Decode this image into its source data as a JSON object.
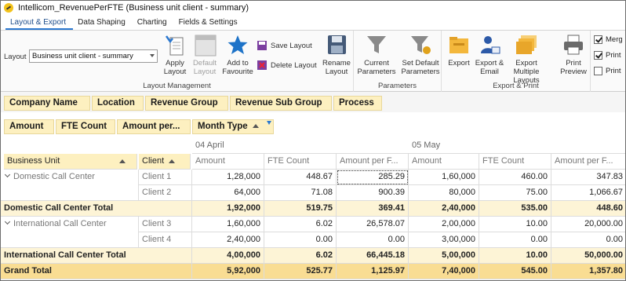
{
  "window": {
    "title": "Intellicom_RevenuePerFTE (Business unit client - summary)"
  },
  "tabs": [
    "Layout & Export",
    "Data Shaping",
    "Charting",
    "Fields & Settings"
  ],
  "ribbon": {
    "layout_label": "Layout",
    "layout_value": "Business unit client - summary",
    "apply_layout": "Apply Layout",
    "default_layout": "Default Layout",
    "add_to_favourite": "Add to Favourite",
    "save_layout": "Save Layout",
    "delete_layout": "Delete Layout",
    "rename_layout": "Rename Layout",
    "group_layout": "Layout Management",
    "current_parameters": "Current Parameters",
    "set_default_parameters": "Set Default Parameters",
    "group_parameters": "Parameters",
    "export": "Export",
    "export_email": "Export & Email",
    "export_multiple": "Export Multiple Layouts",
    "print_preview": "Print Preview",
    "group_export": "Export & Print",
    "options": [
      {
        "label": "Merg",
        "checked": true
      },
      {
        "label": "Print",
        "checked": true
      },
      {
        "label": "Print",
        "checked": false
      }
    ]
  },
  "filter_fields": [
    "Company Name",
    "Location",
    "Revenue Group",
    "Revenue Sub Group",
    "Process"
  ],
  "data_fields": [
    "Amount",
    "FTE Count",
    "Amount per..."
  ],
  "column_field": "Month Type",
  "row_fields": [
    "Business Unit",
    "Client"
  ],
  "months": [
    "04 April",
    "05 May"
  ],
  "measure_headers": [
    "Amount",
    "FTE Count",
    "Amount per F...",
    "Amount",
    "FTE Count",
    "Amount per F..."
  ],
  "rows": [
    {
      "unit": "Domestic Call Center",
      "client": "Client 1",
      "values": [
        "1,28,000",
        "448.67",
        "285.29",
        "1,60,000",
        "460.00",
        "347.83"
      ]
    },
    {
      "unit": "",
      "client": "Client 2",
      "values": [
        "64,000",
        "71.08",
        "900.39",
        "80,000",
        "75.00",
        "1,066.67"
      ]
    },
    {
      "total": "Domestic Call Center Total",
      "values": [
        "1,92,000",
        "519.75",
        "369.41",
        "2,40,000",
        "535.00",
        "448.60"
      ]
    },
    {
      "unit": "International Call Center",
      "client": "Client 3",
      "values": [
        "1,60,000",
        "6.02",
        "26,578.07",
        "2,00,000",
        "10.00",
        "20,000.00"
      ]
    },
    {
      "unit": "",
      "client": "Client 4",
      "values": [
        "2,40,000",
        "0.00",
        "0.00",
        "3,00,000",
        "0.00",
        "0.00"
      ]
    },
    {
      "total": "International Call Center Total",
      "values": [
        "4,00,000",
        "6.02",
        "66,445.18",
        "5,00,000",
        "10.00",
        "50,000.00"
      ]
    },
    {
      "grand": "Grand Total",
      "values": [
        "5,92,000",
        "525.77",
        "1,125.97",
        "7,40,000",
        "545.00",
        "1,357.80"
      ]
    }
  ],
  "colors": {
    "accent": "#2b78d0",
    "field_chip": "#fdf0c0",
    "total_row": "#fdf4d6",
    "grand_total": "#f9dd93"
  }
}
